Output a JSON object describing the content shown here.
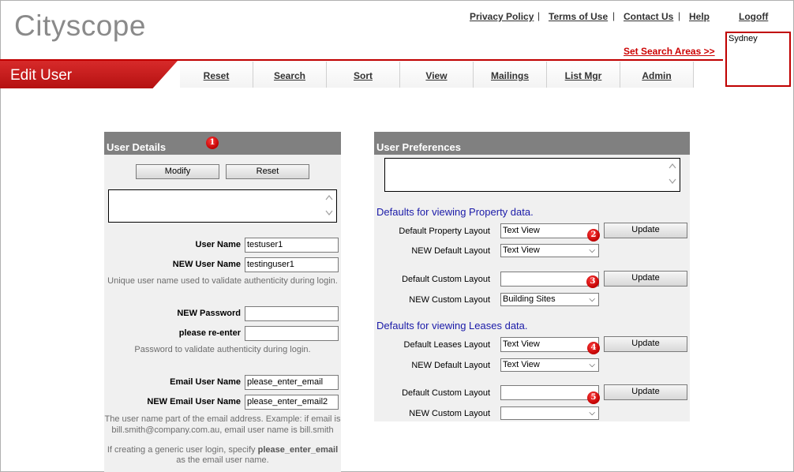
{
  "app": {
    "logo": "Cityscope"
  },
  "top_links": [
    {
      "label": "Privacy Policy"
    },
    {
      "label": "Terms of Use"
    },
    {
      "label": "Contact Us"
    },
    {
      "label": "Help"
    }
  ],
  "separator": "|",
  "logoff": "Logoff",
  "set_search_areas": "Set Search Areas >>",
  "search_area": "Sydney",
  "page_title": "Edit User",
  "nav_tabs": [
    "Reset",
    "Search",
    "Sort",
    "View",
    "Mailings",
    "List Mgr",
    "Admin"
  ],
  "user_details": {
    "title": "User Details",
    "marker": "1",
    "modify_label": "Modify",
    "reset_label": "Reset",
    "user_name_label": "User Name",
    "user_name_value": "testuser1",
    "new_user_name_label": "NEW User Name",
    "new_user_name_value": "testinguser1",
    "user_name_hint": "Unique user name used to validate authenticity during login.",
    "new_password_label": "NEW Password",
    "reenter_label": "please re-enter",
    "password_hint": "Password to validate authenticity during login.",
    "email_user_name_label": "Email User Name",
    "email_user_name_value": "please_enter_email",
    "new_email_user_name_label": "NEW Email User Name",
    "new_email_user_name_value": "please_enter_email2",
    "email_hint_1": "The user name part of the email address. Example: if email is",
    "email_hint_2": "bill.smith@company.com.au, email user name is bill.smith",
    "generic_hint_1": "If creating a generic user login, specify",
    "generic_hint_bold": "please_enter_email",
    "generic_hint_2": "as the email user name."
  },
  "user_prefs": {
    "title": "User Preferences",
    "property_heading": "Defaults for viewing Property data.",
    "leases_heading": "Defaults for viewing Leases data.",
    "update_label": "Update",
    "rows": [
      {
        "label": "Default Property Layout",
        "value": "Text View",
        "marker": "2"
      },
      {
        "label": "NEW Default Layout",
        "value": "Text View"
      },
      {
        "label": "Default Custom Layout",
        "value": "",
        "marker": "3"
      },
      {
        "label": "NEW Custom Layout",
        "value": "Building Sites"
      },
      {
        "label": "Default Leases Layout",
        "value": "Text View",
        "marker": "4"
      },
      {
        "label": "NEW Default Layout",
        "value": "Text View"
      },
      {
        "label": "Default Custom Layout",
        "value": "",
        "marker": "5"
      },
      {
        "label": "NEW Custom Layout",
        "value": ""
      }
    ]
  },
  "colors": {
    "brand_red": "#c00000",
    "panel_header": "#808080",
    "link_blue": "#1a1aa8"
  },
  "icons": {
    "dropdown": "chevron-down-icon",
    "scroll": "scroll-arrows-icon"
  }
}
